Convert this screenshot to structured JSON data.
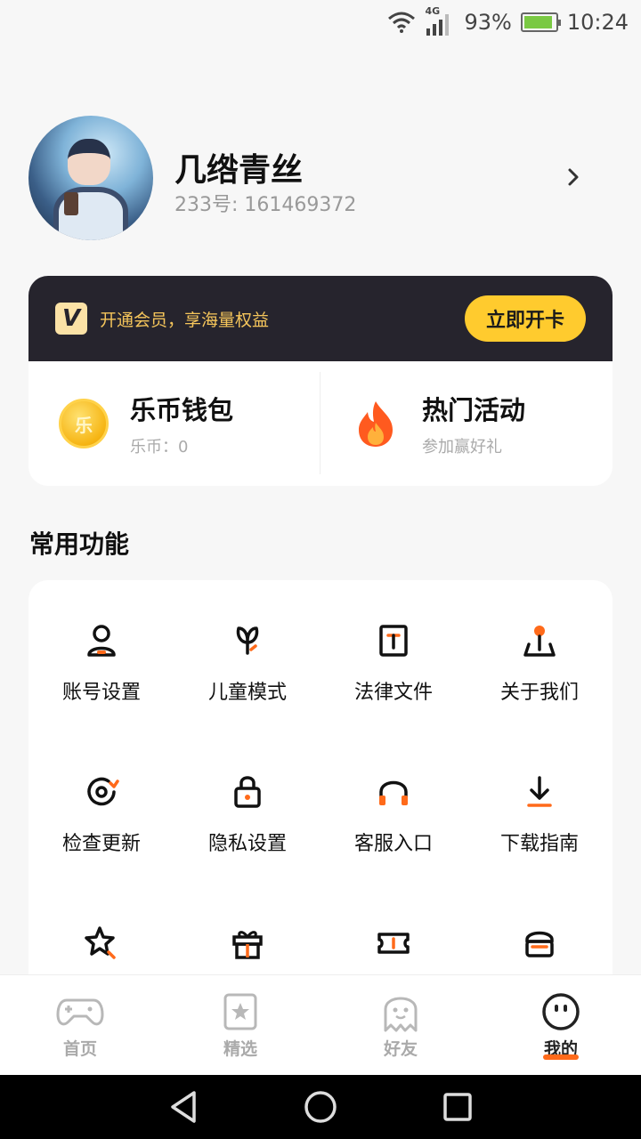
{
  "status_bar": {
    "network_tag": "4G",
    "battery": "93%",
    "battery_level": 0.93,
    "time": "10:24"
  },
  "profile": {
    "name": "几绺青丝",
    "uid": "233号: 161469372"
  },
  "vip": {
    "logo": "V",
    "text": "开通会员，享海量权益",
    "button": "立即开卡"
  },
  "wallet": {
    "coin_glyph": "乐",
    "title": "乐币钱包",
    "sub": "乐币：0"
  },
  "activity": {
    "title": "热门活动",
    "sub": "参加赢好礼"
  },
  "section_title": "常用功能",
  "functions": [
    {
      "label": "账号设置",
      "icon": "account-icon"
    },
    {
      "label": "儿童模式",
      "icon": "sprout-icon"
    },
    {
      "label": "法律文件",
      "icon": "document-icon"
    },
    {
      "label": "关于我们",
      "icon": "location-pin-icon"
    },
    {
      "label": "检查更新",
      "icon": "refresh-icon"
    },
    {
      "label": "隐私设置",
      "icon": "lock-icon"
    },
    {
      "label": "客服入口",
      "icon": "headset-icon"
    },
    {
      "label": "下载指南",
      "icon": "download-icon"
    },
    {
      "label": "",
      "icon": "star-search-icon"
    },
    {
      "label": "",
      "icon": "gift-icon"
    },
    {
      "label": "",
      "icon": "ticket-icon"
    },
    {
      "label": "",
      "icon": "store-icon"
    }
  ],
  "tabs": [
    {
      "label": "首页",
      "icon": "gamepad-icon",
      "active": false
    },
    {
      "label": "精选",
      "icon": "star-card-icon",
      "active": false
    },
    {
      "label": "好友",
      "icon": "ghost-icon",
      "active": false
    },
    {
      "label": "我的",
      "icon": "smile-icon",
      "active": true
    }
  ],
  "colors": {
    "accent": "#ff6a1a",
    "vip_bg": "#26242d",
    "vip_button": "#ffcb2e",
    "vip_text": "#f6c65b"
  }
}
